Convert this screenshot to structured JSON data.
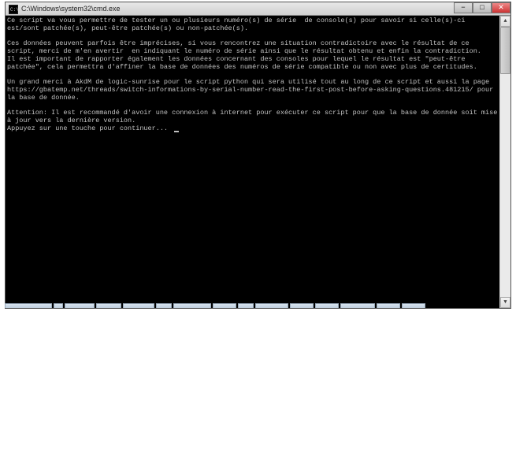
{
  "window": {
    "title": "C:\\Windows\\system32\\cmd.exe",
    "icon_name": "cmd-icon"
  },
  "controls": {
    "minimize_glyph": "−",
    "maximize_glyph": "□",
    "close_glyph": "✕"
  },
  "scrollbar": {
    "up_glyph": "▲",
    "down_glyph": "▼"
  },
  "console": {
    "line1": "Ce script va vous permettre de tester un ou plusieurs numéro(s) de série  de console(s) pour savoir si celle(s)-ci est/sont patchée(s), peut-être patchée(s) ou non-patchée(s).",
    "line2": "",
    "line3": "Ces données peuvent parfois être imprécises, si vous rencontrez une situation contradictoire avec le résultat de ce script, merci de m'en avertir  en indiquant le numéro de série ainsi que le résultat obtenu et enfin la contradiction.",
    "line4": "Il est important de rapporter également les données concernant des consoles pour lequel le résultat est \"peut-être patchée\", cela permettra d'affiner la base de données des numéros de série compatible ou non avec plus de certitudes.",
    "line5": "",
    "line6": "Un grand merci à AkdM de logic-sunrise pour le script python qui sera utilisé tout au long de ce script et aussi la page https://gbatemp.net/threads/switch-informations-by-serial-number-read-the-first-post-before-asking-questions.481215/ pour la base de donnée.",
    "line7": "",
    "line8": "Attention: Il est recommandé d'avoir une connexion à internet pour exécuter ce script pour que la base de donnée soit mise à jour vers la dernière version.",
    "line9": "Appuyez sur une touche pour continuer... "
  },
  "taskbar_widths": [
    60,
    12,
    38,
    32,
    40,
    20,
    48,
    30,
    20,
    42,
    30,
    30,
    44,
    30,
    30
  ]
}
